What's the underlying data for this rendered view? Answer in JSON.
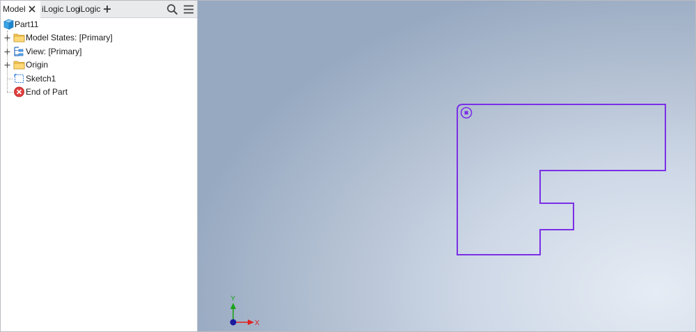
{
  "browser": {
    "tabs": [
      {
        "label": "Model",
        "active": true
      },
      {
        "label": "iLogic Log",
        "active": false
      },
      {
        "label": "iLogic",
        "active": false
      }
    ],
    "tab_close_icon": "close-icon",
    "add_tab_icon": "plus-icon",
    "search_icon": "search-icon",
    "menu_icon": "hamburger-menu-icon",
    "tree": {
      "root": {
        "label": "Part11",
        "icon": "part-cube-icon"
      },
      "items": [
        {
          "label": "Model States: [Primary]",
          "icon": "folder-icon",
          "expandable": true
        },
        {
          "label": "View: [Primary]",
          "icon": "view-rep-icon",
          "expandable": true
        },
        {
          "label": "Origin",
          "icon": "folder-icon",
          "expandable": true
        },
        {
          "label": "Sketch1",
          "icon": "sketch-icon",
          "expandable": false
        },
        {
          "label": "End of Part",
          "icon": "end-of-part-icon",
          "expandable": false
        }
      ]
    }
  },
  "viewport": {
    "sketch_color": "#7a2ee6",
    "triad": {
      "x_label": "X",
      "y_label": "Y",
      "x_color": "#e02020",
      "y_color": "#1aa31a",
      "origin_color": "#1b1ba0"
    }
  }
}
